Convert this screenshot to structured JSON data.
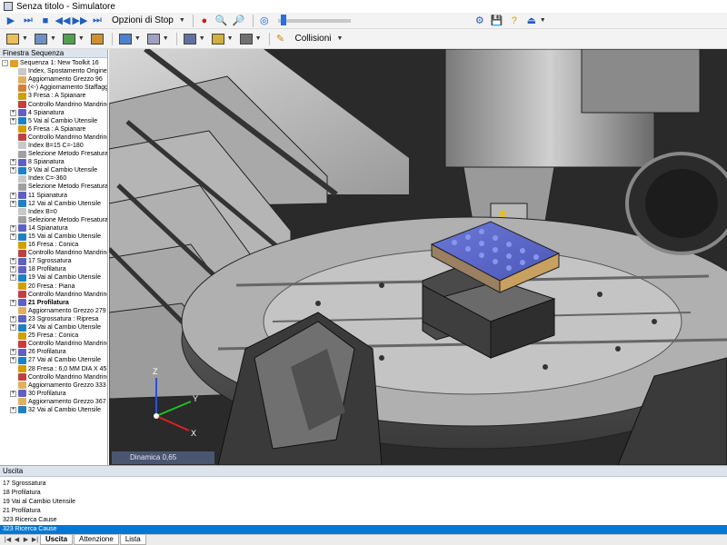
{
  "window": {
    "title": "Senza titolo - Simulatore"
  },
  "toolbar1": {
    "stop_options_label": "Opzioni di Stop",
    "slider_value_fraction": 0.05
  },
  "toolbar2": {
    "collisions_label": "Collisioni"
  },
  "sequence_panel": {
    "title": "Finestra Sequenza",
    "rows": [
      {
        "label": "Sequenza 1: New Toolkit 16",
        "expander": "-",
        "icon": "folder-icon",
        "color": "#e0a020",
        "bold": false
      },
      {
        "label": "Index, Spostamento Origine (I",
        "expander": "",
        "icon": "index-icon",
        "color": "#c8c8c8",
        "bold": false
      },
      {
        "label": "Aggiornamento Grezzo 96",
        "expander": "",
        "icon": "stock-icon",
        "color": "#e0b060",
        "bold": false
      },
      {
        "label": "(<-) Aggiornamento Staffaggi",
        "expander": "",
        "icon": "fixture-icon",
        "color": "#d08040",
        "bold": false
      },
      {
        "label": "3 Fresa : A Spianare",
        "expander": "",
        "icon": "tool-icon",
        "color": "#d0a000",
        "bold": false
      },
      {
        "label": "Controllo Mandrino Mandrino",
        "expander": "",
        "icon": "spindle-icon",
        "color": "#c04040",
        "bold": false
      },
      {
        "label": "4 Spianatura",
        "expander": "+",
        "icon": "operation-icon",
        "color": "#6060c0",
        "bold": false
      },
      {
        "label": "5 Vai al Cambio Utensile",
        "expander": "+",
        "icon": "tool-change-icon",
        "color": "#2080c0",
        "bold": false
      },
      {
        "label": "6 Fresa : A Spianare",
        "expander": "",
        "icon": "tool-icon",
        "color": "#d0a000",
        "bold": false
      },
      {
        "label": "Controllo Mandrino Mandrino",
        "expander": "",
        "icon": "spindle-icon",
        "color": "#c04040",
        "bold": false
      },
      {
        "label": "Index B=15 C=-180",
        "expander": "",
        "icon": "index-icon",
        "color": "#c8c8c8",
        "bold": false
      },
      {
        "label": "Selezione Metodo Fresatura:",
        "expander": "",
        "icon": "method-icon",
        "color": "#a0a0a0",
        "bold": false
      },
      {
        "label": "8 Spianatura",
        "expander": "+",
        "icon": "operation-icon",
        "color": "#6060c0",
        "bold": false
      },
      {
        "label": "9 Vai al Cambio Utensile",
        "expander": "+",
        "icon": "tool-change-icon",
        "color": "#2080c0",
        "bold": false
      },
      {
        "label": "Index C=-360",
        "expander": "",
        "icon": "index-icon",
        "color": "#c8c8c8",
        "bold": false
      },
      {
        "label": "Selezione Metodo Fresatura:",
        "expander": "",
        "icon": "method-icon",
        "color": "#a0a0a0",
        "bold": false
      },
      {
        "label": "11 Spianatura",
        "expander": "+",
        "icon": "operation-icon",
        "color": "#6060c0",
        "bold": false
      },
      {
        "label": "12 Vai al Cambio Utensile",
        "expander": "+",
        "icon": "tool-change-icon",
        "color": "#2080c0",
        "bold": false
      },
      {
        "label": "Index B=0",
        "expander": "",
        "icon": "index-icon",
        "color": "#c8c8c8",
        "bold": false
      },
      {
        "label": "Selezione Metodo Fresatura:",
        "expander": "",
        "icon": "method-icon",
        "color": "#a0a0a0",
        "bold": false
      },
      {
        "label": "14 Spianatura",
        "expander": "+",
        "icon": "operation-icon",
        "color": "#6060c0",
        "bold": false
      },
      {
        "label": "15 Vai al Cambio Utensile",
        "expander": "+",
        "icon": "tool-change-icon",
        "color": "#2080c0",
        "bold": false
      },
      {
        "label": "16 Fresa : Conica",
        "expander": "",
        "icon": "tool-icon",
        "color": "#d0a000",
        "bold": false
      },
      {
        "label": "Controllo Mandrino Mandrino",
        "expander": "",
        "icon": "spindle-icon",
        "color": "#c04040",
        "bold": false
      },
      {
        "label": "17 Sgrossatura",
        "expander": "+",
        "icon": "operation-icon",
        "color": "#6060c0",
        "bold": false
      },
      {
        "label": "18 Profilatura",
        "expander": "+",
        "icon": "operation-icon",
        "color": "#6060c0",
        "bold": false
      },
      {
        "label": "19 Vai al Cambio Utensile",
        "expander": "+",
        "icon": "tool-change-icon",
        "color": "#2080c0",
        "bold": false
      },
      {
        "label": "20 Fresa : Piana",
        "expander": "",
        "icon": "tool-icon",
        "color": "#d0a000",
        "bold": false
      },
      {
        "label": "Controllo Mandrino Mandrino",
        "expander": "",
        "icon": "spindle-icon",
        "color": "#c04040",
        "bold": false
      },
      {
        "label": "21 Profilatura",
        "expander": "+",
        "icon": "operation-icon",
        "color": "#6060c0",
        "bold": true
      },
      {
        "label": "Aggiornamento Grezzo 279",
        "expander": "",
        "icon": "stock-icon",
        "color": "#e0b060",
        "bold": false
      },
      {
        "label": "23 Sgrossatura : Ripresa",
        "expander": "+",
        "icon": "operation-icon",
        "color": "#6060c0",
        "bold": false
      },
      {
        "label": "24 Vai al Cambio Utensile",
        "expander": "+",
        "icon": "tool-change-icon",
        "color": "#2080c0",
        "bold": false
      },
      {
        "label": "25 Fresa : Conica",
        "expander": "",
        "icon": "tool-icon",
        "color": "#d0a000",
        "bold": false
      },
      {
        "label": "Controllo Mandrino Mandrino",
        "expander": "",
        "icon": "spindle-icon",
        "color": "#c04040",
        "bold": false
      },
      {
        "label": "26 Profilatura",
        "expander": "+",
        "icon": "operation-icon",
        "color": "#6060c0",
        "bold": false
      },
      {
        "label": "27 Vai al Cambio Utensile",
        "expander": "+",
        "icon": "tool-change-icon",
        "color": "#2080c0",
        "bold": false
      },
      {
        "label": "28 Fresa : 6,0 MM DIA X 45 D",
        "expander": "",
        "icon": "tool-icon",
        "color": "#d0a000",
        "bold": false
      },
      {
        "label": "Controllo Mandrino Mandrino",
        "expander": "",
        "icon": "spindle-icon",
        "color": "#c04040",
        "bold": false
      },
      {
        "label": "Aggiornamento Grezzo 333",
        "expander": "",
        "icon": "stock-icon",
        "color": "#e0b060",
        "bold": false
      },
      {
        "label": "30 Profilatura",
        "expander": "+",
        "icon": "operation-icon",
        "color": "#6060c0",
        "bold": false
      },
      {
        "label": "Aggiornamento Grezzo 367",
        "expander": "",
        "icon": "stock-icon",
        "color": "#e0b060",
        "bold": false
      },
      {
        "label": "32 Vai al Cambio Utensile",
        "expander": "+",
        "icon": "tool-change-icon",
        "color": "#2080c0",
        "bold": false
      }
    ]
  },
  "viewport": {
    "dynamics_label": "Dinamica 0,65",
    "axes": {
      "z": "Z",
      "y": "Y",
      "x": "X"
    }
  },
  "output_panel": {
    "title": "Uscita",
    "lines": [
      {
        "text": "17 Sgrossatura",
        "selected": false
      },
      {
        "text": "18 Profilatura",
        "selected": false
      },
      {
        "text": "19 Vai al Cambio Utensile",
        "selected": false
      },
      {
        "text": "21 Profilatura",
        "selected": false
      },
      {
        "text": "323 Ricerca Cause",
        "selected": false
      },
      {
        "text": "323 Ricerca Cause",
        "selected": true
      }
    ]
  },
  "bottom_tabs": [
    {
      "label": "Uscita",
      "active": true
    },
    {
      "label": "Attenzione",
      "active": false
    },
    {
      "label": "Lista",
      "active": false
    }
  ]
}
